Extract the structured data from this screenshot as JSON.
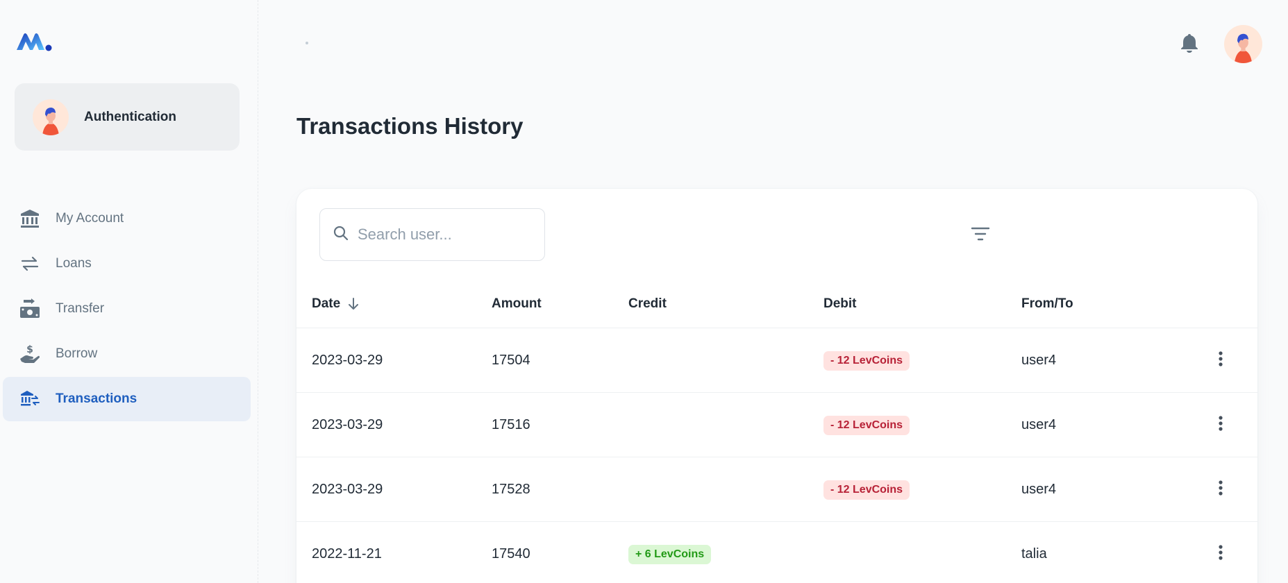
{
  "sidebar": {
    "account": {
      "name": "Authentication"
    },
    "items": [
      {
        "label": "My Account",
        "icon": "bank-icon",
        "active": false
      },
      {
        "label": "Loans",
        "icon": "swap-arrows-icon",
        "active": false
      },
      {
        "label": "Transfer",
        "icon": "money-transfer-icon",
        "active": false
      },
      {
        "label": "Borrow",
        "icon": "hand-dollar-icon",
        "active": false
      },
      {
        "label": "Transactions",
        "icon": "bank-transfer-icon",
        "active": true
      }
    ]
  },
  "page": {
    "title": "Transactions History"
  },
  "search": {
    "placeholder": "Search user..."
  },
  "table": {
    "columns": [
      "Date",
      "Amount",
      "Credit",
      "Debit",
      "From/To"
    ],
    "sort_column": "Date",
    "sort_direction": "descending",
    "rows": [
      {
        "date": "2023-03-29",
        "amount": "17504",
        "credit": "",
        "debit": "- 12 LevCoins",
        "from_to": "user4"
      },
      {
        "date": "2023-03-29",
        "amount": "17516",
        "credit": "",
        "debit": "- 12 LevCoins",
        "from_to": "user4"
      },
      {
        "date": "2023-03-29",
        "amount": "17528",
        "credit": "",
        "debit": "- 12 LevCoins",
        "from_to": "user4"
      },
      {
        "date": "2022-11-21",
        "amount": "17540",
        "credit": "+ 6 LevCoins",
        "debit": "",
        "from_to": "talia"
      }
    ]
  },
  "colors": {
    "accent": "#1f5fbf",
    "debit_bg": "#ffe2e0",
    "debit_text": "#b72136",
    "credit_bg": "#dbf7d4",
    "credit_text": "#229a16"
  }
}
